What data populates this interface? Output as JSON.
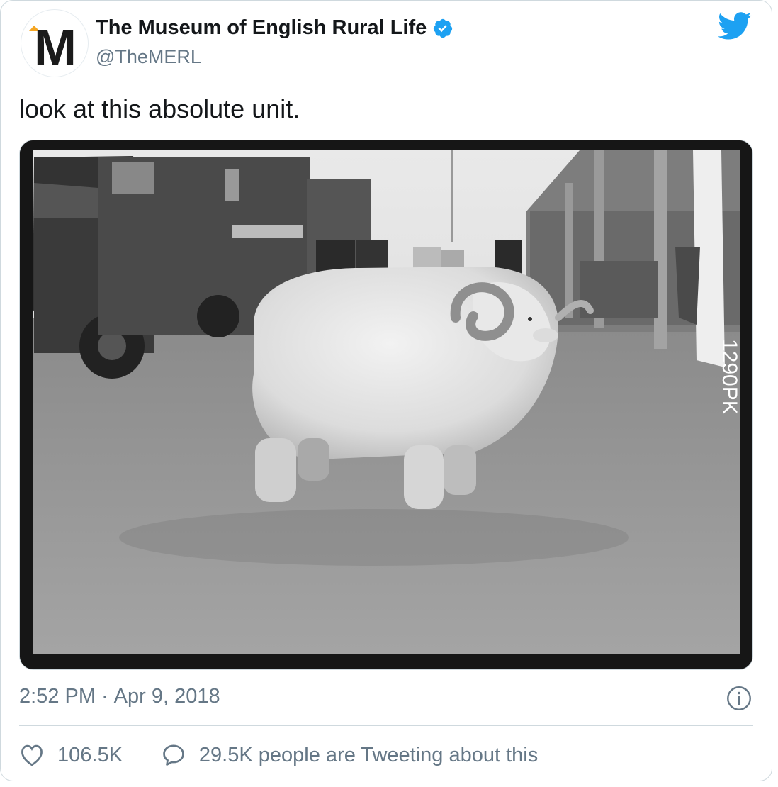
{
  "account": {
    "display_name": "The Museum of English Rural Life",
    "handle": "@TheMERL",
    "avatar_letter": "M",
    "verified": true
  },
  "tweet": {
    "text": "look at this absolute unit.",
    "time": "2:52 PM",
    "separator": "·",
    "date": "Apr 9, 2018"
  },
  "photo": {
    "negative_number": "1290PK"
  },
  "actions": {
    "like_count": "106.5K",
    "conversation_label": "29.5K people are Tweeting about this"
  },
  "icons": {
    "brand": "twitter-bird-icon",
    "verified": "verified-badge-icon",
    "info": "info-icon",
    "like": "heart-icon",
    "reply": "speech-bubble-icon"
  },
  "colors": {
    "twitter_blue": "#1da1f2",
    "text_primary": "#14171a",
    "text_secondary": "#657786",
    "border": "#cfd9de",
    "logo_accent": "#f5a623"
  }
}
